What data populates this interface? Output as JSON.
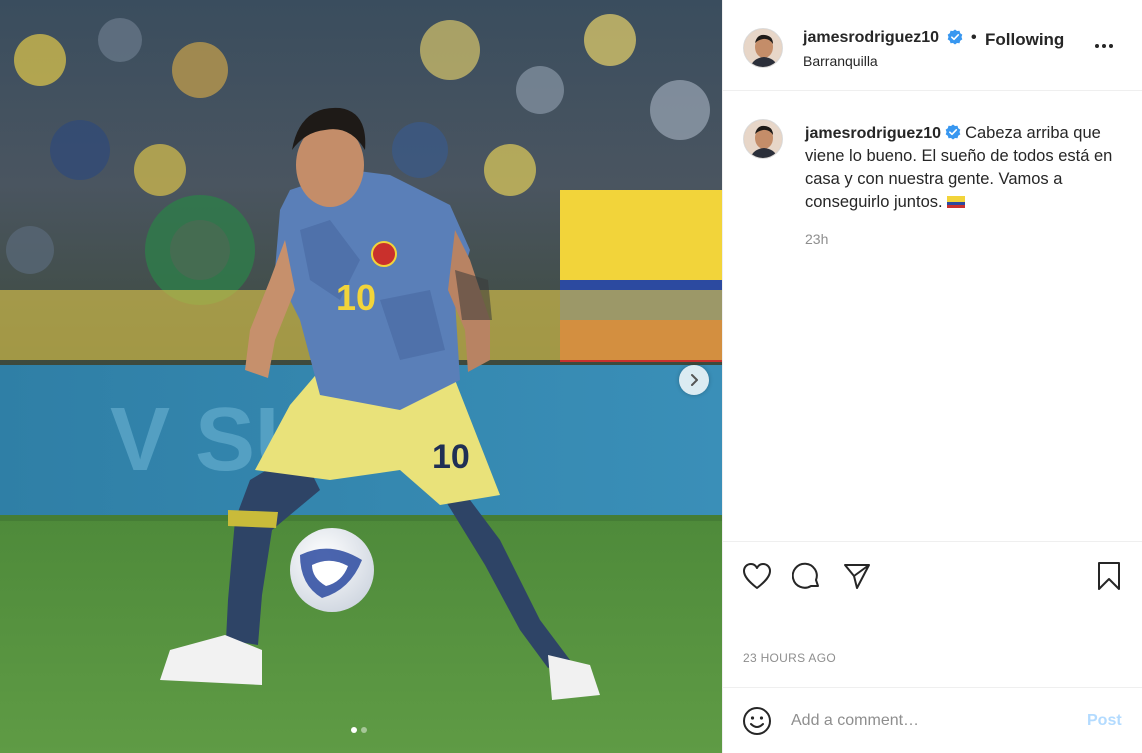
{
  "post": {
    "username": "jamesrodriguez10",
    "verified": true,
    "follow_label": "Following",
    "location": "Barranquilla",
    "caption": {
      "username": "jamesrodriguez10",
      "text": "Cabeza arriba que viene lo bueno. El sueño de todos está en casa y con nuestra gente. Vamos a conseguirlo juntos.",
      "emoji": "colombia-flag-emoji",
      "time_ago": "23h"
    },
    "timestamp": "23 HOURS AGO",
    "comment": {
      "placeholder": "Add a comment…",
      "post_label": "Post"
    },
    "carousel": {
      "total": 2,
      "current": 1
    },
    "player_numbers": {
      "shirt": "10",
      "shorts": "10"
    }
  },
  "icons": {
    "more": "more-options-icon",
    "like": "heart-icon",
    "comment": "comment-bubble-icon",
    "share": "paper-plane-icon",
    "save": "bookmark-icon",
    "emoji": "smiley-icon",
    "next": "chevron-right-icon",
    "verified": "verified-badge-icon"
  },
  "colors": {
    "verified": "#3897f0",
    "post_disabled": "#b3dbff",
    "secondary_text": "#8e8e8e",
    "border": "#efefef"
  }
}
